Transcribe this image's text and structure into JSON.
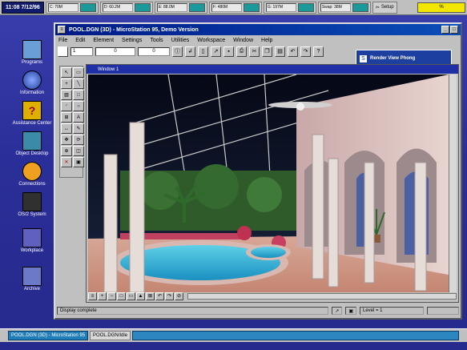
{
  "topbar": {
    "time": "11:08  7/12/96",
    "drives": [
      {
        "label": "C: 70M"
      },
      {
        "label": "D: 60.2M"
      },
      {
        "label": "E: 88.0M"
      },
      {
        "label": "F: 480M"
      },
      {
        "label": "G: 197M"
      },
      {
        "label": "Swap: 38M"
      }
    ],
    "setup_label": "Setup",
    "indicator": "%"
  },
  "desktop": {
    "icons": [
      {
        "label": "Programs",
        "color": "#6a9ed6"
      },
      {
        "label": "Information",
        "color": "#4060b8"
      },
      {
        "label": "Assistance Center",
        "color": "#e0b000"
      },
      {
        "label": "Object Desktop",
        "color": "#3a8aa8"
      },
      {
        "label": "Connections",
        "color": "#f0a020"
      },
      {
        "label": "OS/2 System",
        "color": "#303030"
      },
      {
        "label": "Workplace",
        "color": "#6060c0"
      },
      {
        "label": "Archive",
        "color": "#6a7ac8"
      }
    ]
  },
  "window": {
    "title": "POOL.DGN (3D) - MicroStation 95, Demo Version",
    "menu": [
      "File",
      "Edit",
      "Element",
      "Settings",
      "Tools",
      "Utilities",
      "Workspace",
      "Window",
      "Help"
    ],
    "toolbar": {
      "level_field": "1",
      "color_field": "0",
      "style_field": "0"
    },
    "render_dialog": {
      "title": "Render View Phong"
    },
    "view": {
      "title": "Window 1"
    },
    "status": {
      "message": "Display complete",
      "level": "Level = 1"
    }
  },
  "taskbar": {
    "tasks": [
      {
        "label": "POOL.DGN (3D) - MicroStation 95"
      },
      {
        "label": "POOL.DGN/Idle"
      }
    ]
  }
}
